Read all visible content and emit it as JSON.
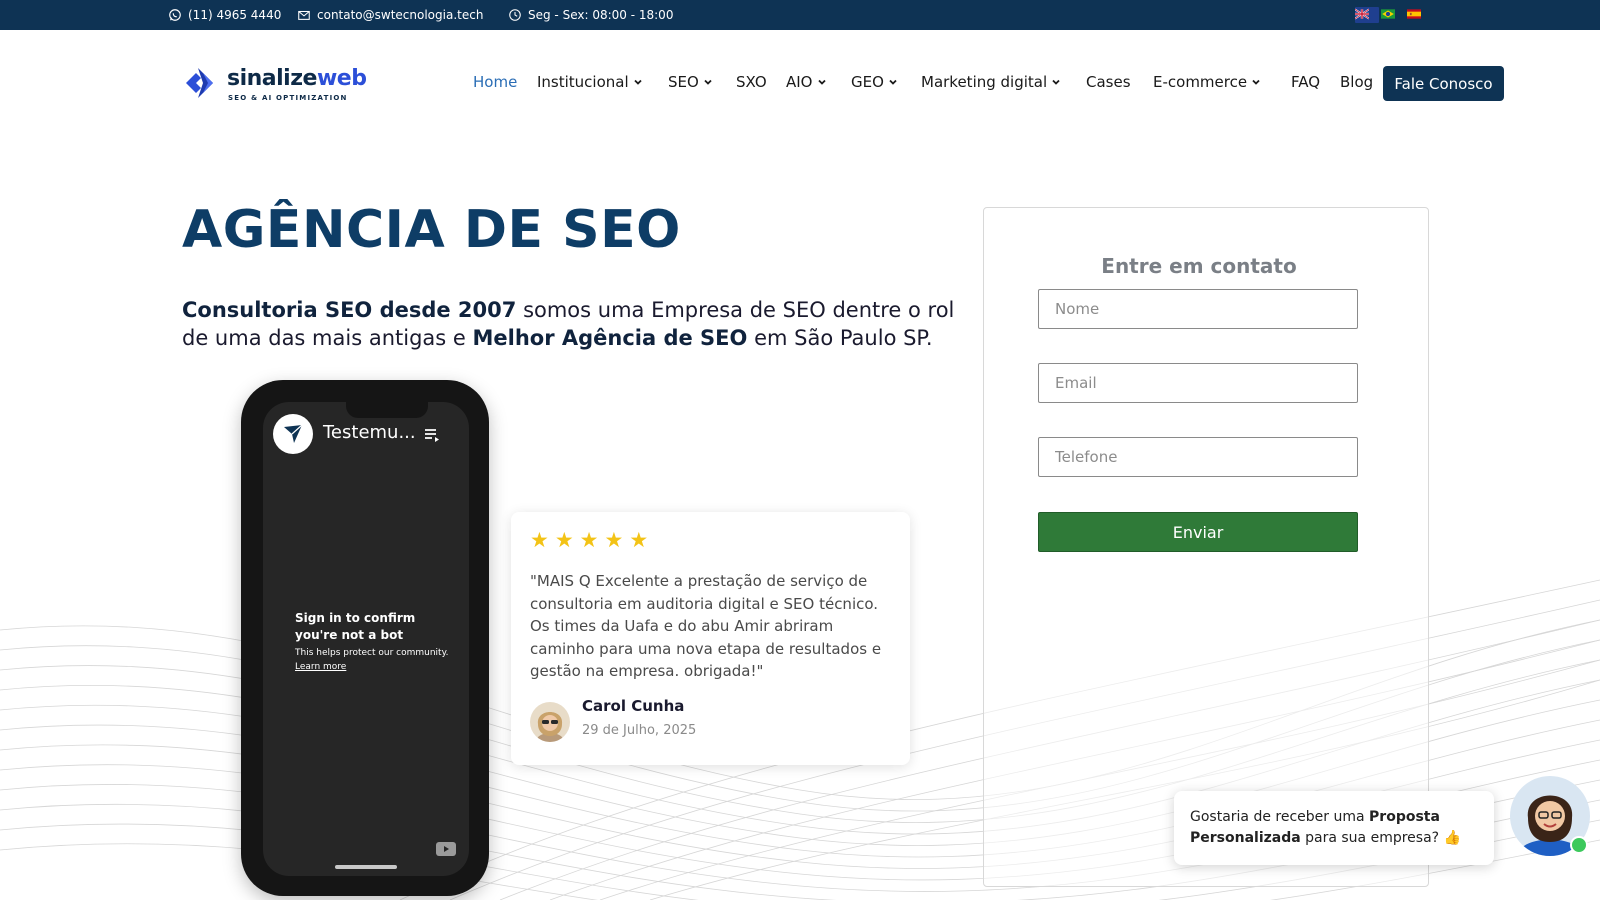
{
  "topbar": {
    "phone": "(11) 4965 4440",
    "email": "contato@swtecnologia.tech",
    "hours": "Seg - Sex: 08:00 - 18:00",
    "flags": [
      "uk-flag-icon",
      "brazil-flag-icon",
      "spain-flag-icon"
    ]
  },
  "header": {
    "logo_word_1": "sinalize",
    "logo_word_2": "web",
    "logo_tagline": "SEO & AI OPTIMIZATION",
    "nav": {
      "home": "Home",
      "institucional": "Institucional",
      "seo": "SEO",
      "sxo": "SXO",
      "aio": "AIO",
      "geo": "GEO",
      "marketing": "Marketing digital",
      "cases": "Cases",
      "ecommerce": "E-commerce",
      "faq": "FAQ",
      "blog": "Blog"
    },
    "cta": "Fale Conosco"
  },
  "hero": {
    "title": "AGÊNCIA DE SEO",
    "text_bold_1": "Consultoria SEO desde 2007",
    "text_part_1": " somos uma Empresa de SEO dentre o rol de uma das mais antigas e ",
    "text_bold_2": "Melhor Agência de SEO",
    "text_part_2": " em São Paulo SP."
  },
  "video": {
    "title": "Testemu...",
    "bot_title": "Sign in to confirm you're not a bot",
    "bot_subtitle": "This helps protect our community.",
    "bot_link": "Learn more"
  },
  "review": {
    "stars": [
      "★",
      "★",
      "★",
      "★",
      "★"
    ],
    "rating": 5,
    "text": "\"MAIS Q Excelente a prestação de serviço de consultoria em auditoria digital e SEO técnico. Os times da Uafa e do abu Amir abriram caminho para uma nova etapa de resultados e gestão na empresa. obrigada!\"",
    "name": "Carol Cunha",
    "date": "29 de Julho, 2025"
  },
  "contact_form": {
    "title": "Entre em contato",
    "name_placeholder": "Nome",
    "email_placeholder": "Email",
    "phone_placeholder": "Telefone",
    "submit": "Enviar"
  },
  "chat": {
    "text_1": "Gostaria de receber uma ",
    "text_bold": "Proposta Personalizada",
    "text_2": " para sua empresa? 👍"
  },
  "colors": {
    "topbar": "#0e3354",
    "title": "#0e3d66",
    "accent_nav": "#2a6db5",
    "submit": "#2f7a38",
    "stars": "#f3c316"
  }
}
